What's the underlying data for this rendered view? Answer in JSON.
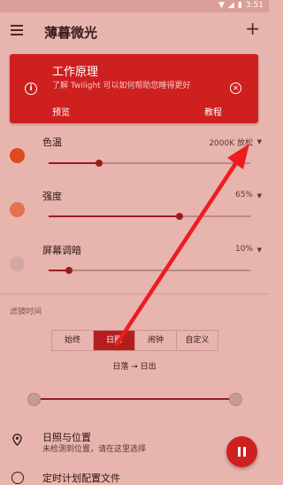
{
  "status_bar": {
    "time": "3:51"
  },
  "app_bar": {
    "title": "薄暮微光"
  },
  "info_card": {
    "title": "工作原理",
    "description": "了解 Twilight 可以如何帮助您睡得更好",
    "preview_label": "预览",
    "tutorial_label": "教程",
    "color": "#cf2020"
  },
  "settings": {
    "color_temp": {
      "label": "色温",
      "value": "2000K 放松",
      "level": 0.25,
      "dot_color": "#e0481e"
    },
    "intensity": {
      "label": "强度",
      "value": "65%",
      "level": 0.65,
      "dot_color": "#e4714e"
    },
    "dim": {
      "label": "屏幕调暗",
      "value": "10%",
      "level": 0.1,
      "dot_color": "#d3a8a3"
    }
  },
  "filter": {
    "section_label": "滤镜时间",
    "options": [
      "始终",
      "日照",
      "闹钟",
      "自定义"
    ],
    "selected": "日照",
    "range_label": "日落 → 日出",
    "range_start": 0.0,
    "range_end": 1.0
  },
  "location": {
    "title": "日照与位置",
    "subtitle": "未检测到位置，请在这里选择"
  },
  "next_item": {
    "title": "定时计划配置文件"
  },
  "fab": {
    "icon": "pause-icon"
  }
}
